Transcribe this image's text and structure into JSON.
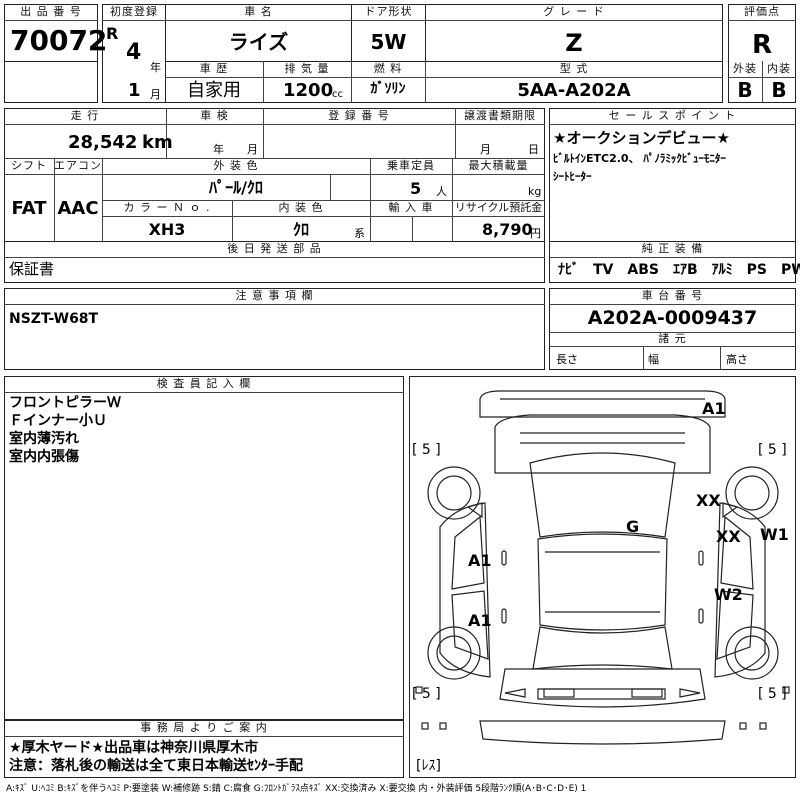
{
  "header": {
    "lot_number_label": "出 品 番 号",
    "lot_number": "70072",
    "first_reg_label": "初度登録",
    "era": "R",
    "reg_year": "4",
    "year_unit": "年",
    "reg_month": "1",
    "month_unit": "月",
    "car_name_label": "車 名",
    "car_name": "ライズ",
    "door_label": "ドア形状",
    "door": "5W",
    "grade_label": "グ レ ー ド",
    "grade": "Z",
    "score_label": "評価点",
    "score": "R",
    "history_label": "車 歴",
    "history": "自家用",
    "displacement_label": "排 気 量",
    "displacement": "1200",
    "displacement_unit": "cc",
    "fuel_label": "燃 料",
    "fuel": "ｶﾞｿﾘﾝ",
    "model_label": "型 式",
    "model": "5AA-A202A",
    "exterior_label": "外装",
    "exterior_score": "B",
    "interior_label": "内装",
    "interior_score": "B"
  },
  "row2": {
    "mileage_label": "走 行",
    "mileage": "28,542",
    "mileage_unit": "km",
    "inspection_label": "車 検",
    "inspection_year_unit": "年",
    "inspection_month_unit": "月",
    "reg_number_label": "登 録 番 号",
    "transfer_label": "譲渡書類期限",
    "transfer_month_unit": "月",
    "transfer_day_unit": "日",
    "shift_label": "シフト",
    "shift": "FAT",
    "ac_label": "エアコン",
    "ac": "AAC",
    "exterior_color_label": "外 装 色",
    "exterior_color": "ﾊﾟｰﾙ/ｸﾛ",
    "capacity_label": "乗車定員",
    "capacity": "5",
    "capacity_unit": "人",
    "max_load_label": "最大積載量",
    "max_load_unit": "kg",
    "color_no_label": "カ ラ ー Ｎ ｏ .",
    "color_no": "XH3",
    "interior_color_label": "内 装 色",
    "interior_color": "ｸﾛ",
    "interior_color_unit": "系",
    "import_label": "輸 入 車",
    "recycle_label": "リサイクル預託金",
    "recycle": "8,790",
    "recycle_unit": "円"
  },
  "sales_point": {
    "label": "セ ー ル ス ポ イ ン ト",
    "lines": [
      "★オークションデビュー★",
      "ﾋﾞﾙﾄｲﾝETC2.0、 ﾊﾟﾉﾗﾐｯｸﾋﾞｭｰﾓﾆﾀｰ",
      "ｼｰﾄﾋｰﾀｰ"
    ]
  },
  "later_parts": {
    "label": "後 日 発 送 部 品",
    "value": "保証書"
  },
  "equipment": {
    "label": "純 正 装 備",
    "items": "ﾅﾋﾞ　TV　ABS　ｴｱB　ｱﾙﾐ　PS　PW"
  },
  "notes": {
    "label": "注 意 事 項 欄",
    "value": "NSZT-W68T"
  },
  "chassis": {
    "label": "車 台 番 号",
    "value": "A202A-0009437",
    "specs_label": "諸 元",
    "length_label": "長さ",
    "width_label": "幅",
    "height_label": "高さ"
  },
  "inspector": {
    "label": "検 査 員 記 入 欄",
    "lines": [
      "フロントピラーＷ",
      "Ｆインナー小Ｕ",
      "室内薄汚れ",
      "室内内張傷"
    ]
  },
  "office": {
    "label": "事 務 局 よ り ご 案 内",
    "line1": "★厚木ヤード★出品車は神奈川県厚木市",
    "line2": "注意：落札後の輸送は全て東日本輸送ｾﾝﾀｰ手配"
  },
  "diagram": {
    "tire_fl": "[ 5 ]",
    "tire_fr": "[ 5 ]",
    "tire_rl": "[ 5 ]",
    "tire_rr": "[ 5 ]",
    "spare": "[ﾚｽ]",
    "mark_a1_top": "A1",
    "mark_xx1": "XX",
    "mark_xx2": "XX",
    "mark_w1": "W1",
    "mark_g": "G",
    "mark_a1_left1": "A1",
    "mark_a1_left2": "A1",
    "mark_w2": "W2"
  },
  "legend": "A:ｷｽﾞ U:ﾍｺﾐ B:ｷｽﾞを伴うﾍｺﾐ P:要塗装 W:補修跡 S:錆 C:腐食 G:ﾌﾛﾝﾄｶﾞﾗｽ点ｷｽﾞ XX:交換済み X:要交換 内・外装評価 5段階ﾗﾝｸ順(A･B･C･D･E) 1"
}
